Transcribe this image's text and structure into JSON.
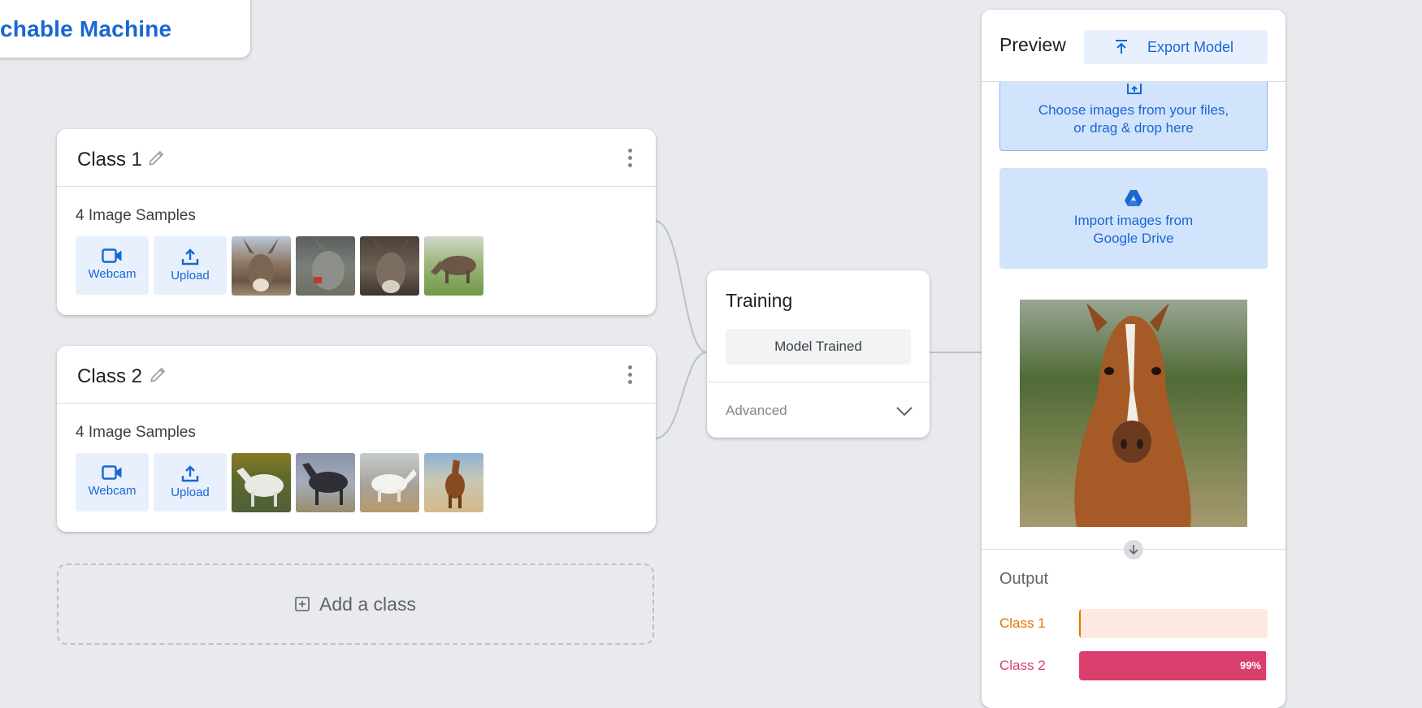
{
  "app": {
    "logo_text": "chable Machine"
  },
  "classes": [
    {
      "name": "Class 1",
      "samples_label": "4 Image Samples",
      "webcam_label": "Webcam",
      "upload_label": "Upload",
      "thumbnails": [
        "donkey-photo-1",
        "donkey-photo-2",
        "donkey-photo-3",
        "donkey-photo-4"
      ]
    },
    {
      "name": "Class 2",
      "samples_label": "4 Image Samples",
      "webcam_label": "Webcam",
      "upload_label": "Upload",
      "thumbnails": [
        "horse-photo-1",
        "horse-photo-2",
        "horse-photo-3",
        "horse-photo-4"
      ]
    }
  ],
  "add_class_label": "Add a class",
  "training": {
    "title": "Training",
    "status_button": "Model Trained",
    "advanced_label": "Advanced"
  },
  "preview": {
    "title": "Preview",
    "export_label": "Export Model",
    "file_drop_line1": "Choose images from your files,",
    "file_drop_line2": "or drag & drop here",
    "drive_line1": "Import images from",
    "drive_line2": "Google Drive",
    "output_title": "Output",
    "outputs": [
      {
        "label": "Class 1",
        "fraction": 0.01,
        "pct_text": "",
        "color": "#e37400",
        "bg": "#fde9df"
      },
      {
        "label": "Class 2",
        "fraction": 0.99,
        "pct_text": "99%",
        "color": "#d93e6d",
        "bg": "#fbe2ea"
      }
    ]
  },
  "colors": {
    "accent": "#1967d2",
    "background": "#e8eaed"
  }
}
